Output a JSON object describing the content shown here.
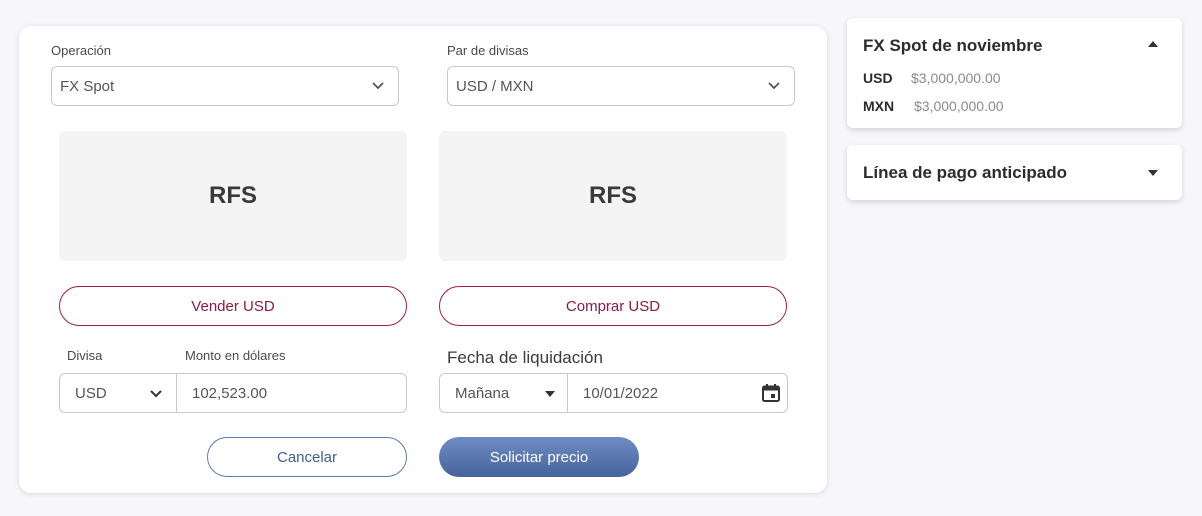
{
  "form": {
    "operacion_label": "Operación",
    "operacion_value": "FX Spot",
    "par_label": "Par de divisas",
    "par_value": "USD / MXN",
    "rfs_left": "RFS",
    "rfs_right": "RFS",
    "sell_label": "Vender USD",
    "buy_label": "Comprar USD",
    "divisa_label": "Divisa",
    "divisa_value": "USD",
    "monto_label": "Monto en dólares",
    "monto_value": "102,523.00",
    "fecha_label": "Fecha de liquidación",
    "fecha_option": "Mañana",
    "fecha_value": "10/01/2022",
    "cancel_label": "Cancelar",
    "submit_label": "Solicitar precio"
  },
  "sidebar": {
    "panel1": {
      "title": "FX Spot de noviembre",
      "rows": [
        {
          "currency": "USD",
          "amount": "$3,000,000.00"
        },
        {
          "currency": "MXN",
          "amount": "$3,000,000.00"
        }
      ]
    },
    "panel2": {
      "title": "Línea de pago anticipado"
    }
  },
  "colors": {
    "accent_red": "#8e1a45",
    "primary_blue": "#46639b",
    "background": "#f7f7fb"
  },
  "icons": [
    "chevron-down-icon",
    "caret-down-icon",
    "caret-up-icon",
    "calendar-icon"
  ]
}
